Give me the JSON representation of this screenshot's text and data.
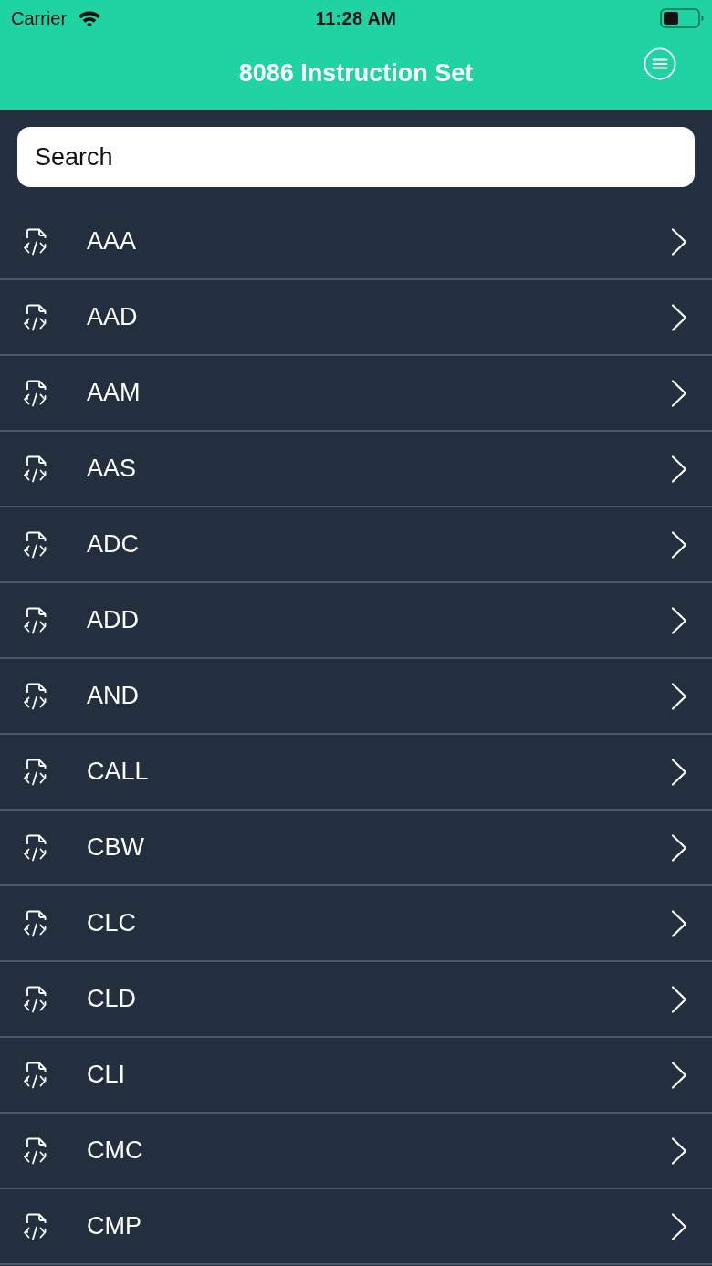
{
  "status_bar": {
    "carrier": "Carrier",
    "time": "11:28 AM"
  },
  "header": {
    "title": "8086 Instruction Set"
  },
  "search": {
    "placeholder": "Search"
  },
  "instructions": [
    {
      "label": "AAA"
    },
    {
      "label": "AAD"
    },
    {
      "label": "AAM"
    },
    {
      "label": "AAS"
    },
    {
      "label": "ADC"
    },
    {
      "label": "ADD"
    },
    {
      "label": "AND"
    },
    {
      "label": "CALL"
    },
    {
      "label": "CBW"
    },
    {
      "label": "CLC"
    },
    {
      "label": "CLD"
    },
    {
      "label": "CLI"
    },
    {
      "label": "CMC"
    },
    {
      "label": "CMP"
    }
  ]
}
